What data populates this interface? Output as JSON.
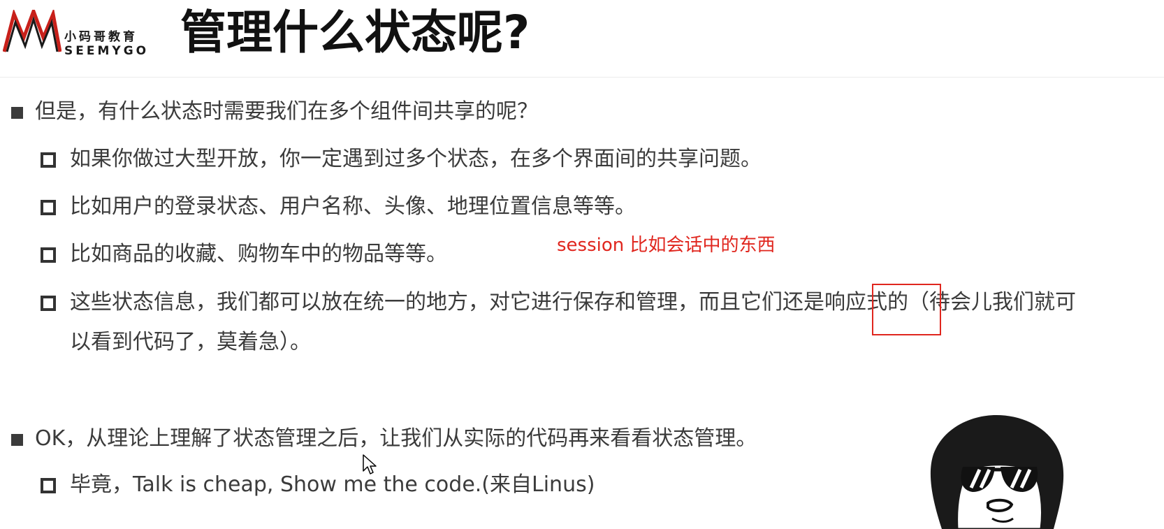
{
  "header": {
    "logo_cn": "小码哥教育",
    "logo_en": "SEEMYGO",
    "title": "管理什么状态呢?"
  },
  "content": {
    "bullet1": "但是，有什么状态时需要我们在多个组件间共享的呢？",
    "sub1": "如果你做过大型开放，你一定遇到过多个状态，在多个界面间的共享问题。",
    "sub2": "比如用户的登录状态、用户名称、头像、地理位置信息等等。",
    "sub3": "比如商品的收藏、购物车中的物品等等。",
    "sub4_line1": "这些状态信息，我们都可以放在统一的地方，对它进行保存和管理，而且它们还是响应式的（待会儿我们就可",
    "sub4_line2": "以看到代码了，莫着急）。",
    "bullet2": "OK，从理论上理解了状态管理之后，让我们从实际的代码再来看看状态管理。",
    "sub5": "毕竟，Talk is cheap, Show me the code.(来自Linus)"
  },
  "annotation": {
    "note": "session 比如会话中的东西"
  },
  "colors": {
    "annotation": "#e0261e",
    "text": "#3b3b3b",
    "title": "#111111"
  },
  "icons": {
    "logo": "seemygo-m-logo",
    "bullet": "filled-square",
    "sub_bullet": "hollow-square",
    "cursor": "mouse-pointer-icon",
    "avatar": "sunglasses-cartoon-avatar"
  }
}
